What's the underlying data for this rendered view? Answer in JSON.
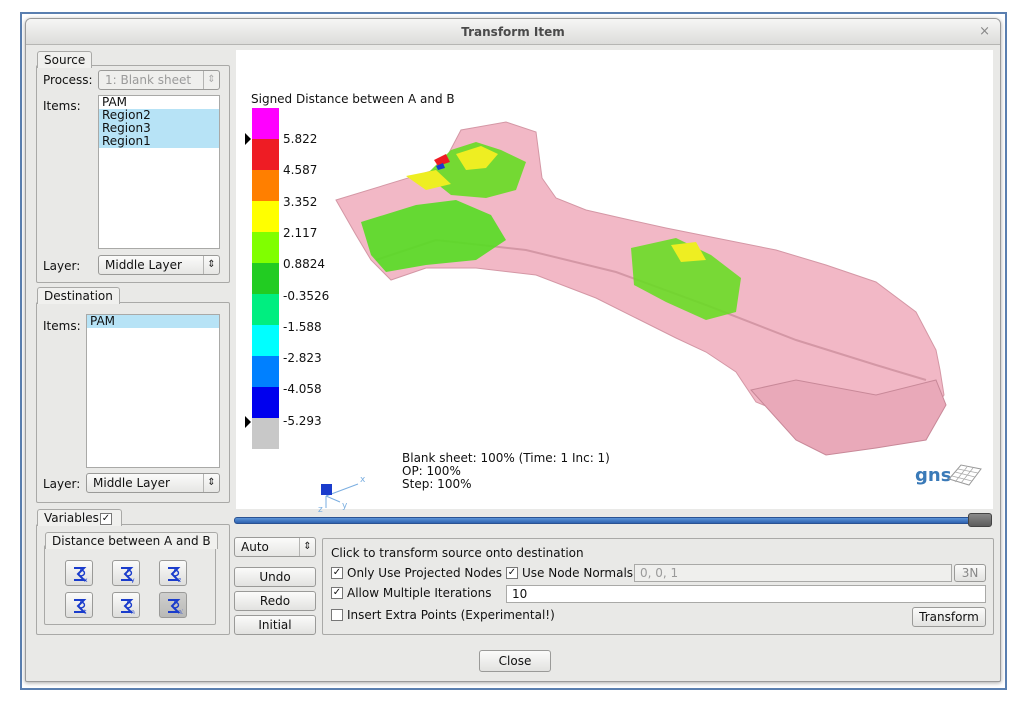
{
  "window": {
    "title": "Transform Item",
    "close_glyph": "×"
  },
  "source": {
    "tab": "Source",
    "process_label": "Process:",
    "process_value": "1: Blank sheet",
    "items_label": "Items:",
    "items": [
      {
        "label": "PAM",
        "selected": false
      },
      {
        "label": "Region2",
        "selected": true
      },
      {
        "label": "Region3",
        "selected": true
      },
      {
        "label": "Region1",
        "selected": true
      }
    ],
    "layer_label": "Layer:",
    "layer_value": "Middle Layer"
  },
  "destination": {
    "tab": "Destination",
    "items_label": "Items:",
    "items": [
      {
        "label": "PAM",
        "selected": true
      }
    ],
    "layer_label": "Layer:",
    "layer_value": "Middle Layer"
  },
  "variables": {
    "tab": "Variables",
    "checked": true,
    "group_title": "Distance between A and B",
    "icons": [
      "distance-x-icon",
      "distance-y-icon",
      "distance-z-icon",
      "distance-t-icon",
      "distance-n-icon",
      "distance-n1-icon"
    ],
    "icon_subscripts": [
      "x",
      "y",
      "z",
      "t",
      "n",
      "n1"
    ]
  },
  "viewport": {
    "legend_title": "Signed Distance between A and B",
    "legend_colors": [
      "#ff00ff",
      "#ee1c24",
      "#ff7f00",
      "#ffff00",
      "#80ff00",
      "#22cc22",
      "#00ee80",
      "#00ffff",
      "#0080ff",
      "#0000ee",
      "#c8c8c8"
    ],
    "legend_values": [
      "5.822",
      "4.587",
      "3.352",
      "2.117",
      "0.8824",
      "-0.3526",
      "-1.588",
      "-2.823",
      "-4.058",
      "-5.293"
    ],
    "info_lines": [
      "Blank sheet: 100% (Time: 1 Inc: 1)",
      "OP: 100%",
      "Step: 100%"
    ],
    "logo": "gns",
    "part_color": "#f2b8c6"
  },
  "slider": {
    "value": 1.0
  },
  "controls": {
    "mode_value": "Auto",
    "undo": "Undo",
    "redo": "Redo",
    "initial": "Initial",
    "hint": "Click to transform source onto destination",
    "only_projected": {
      "label": "Only Use Projected Nodes",
      "checked": true
    },
    "use_normals": {
      "label": "Use Node Normals",
      "checked": true
    },
    "normals_value": "0, 0, 1",
    "normals_button": "3N",
    "allow_multiple": {
      "label": "Allow Multiple Iterations",
      "checked": true
    },
    "iterations_value": "10",
    "extra_points": {
      "label": "Insert Extra Points (Experimental!)",
      "checked": false
    },
    "transform_button": "Transform"
  },
  "footer": {
    "close": "Close"
  }
}
